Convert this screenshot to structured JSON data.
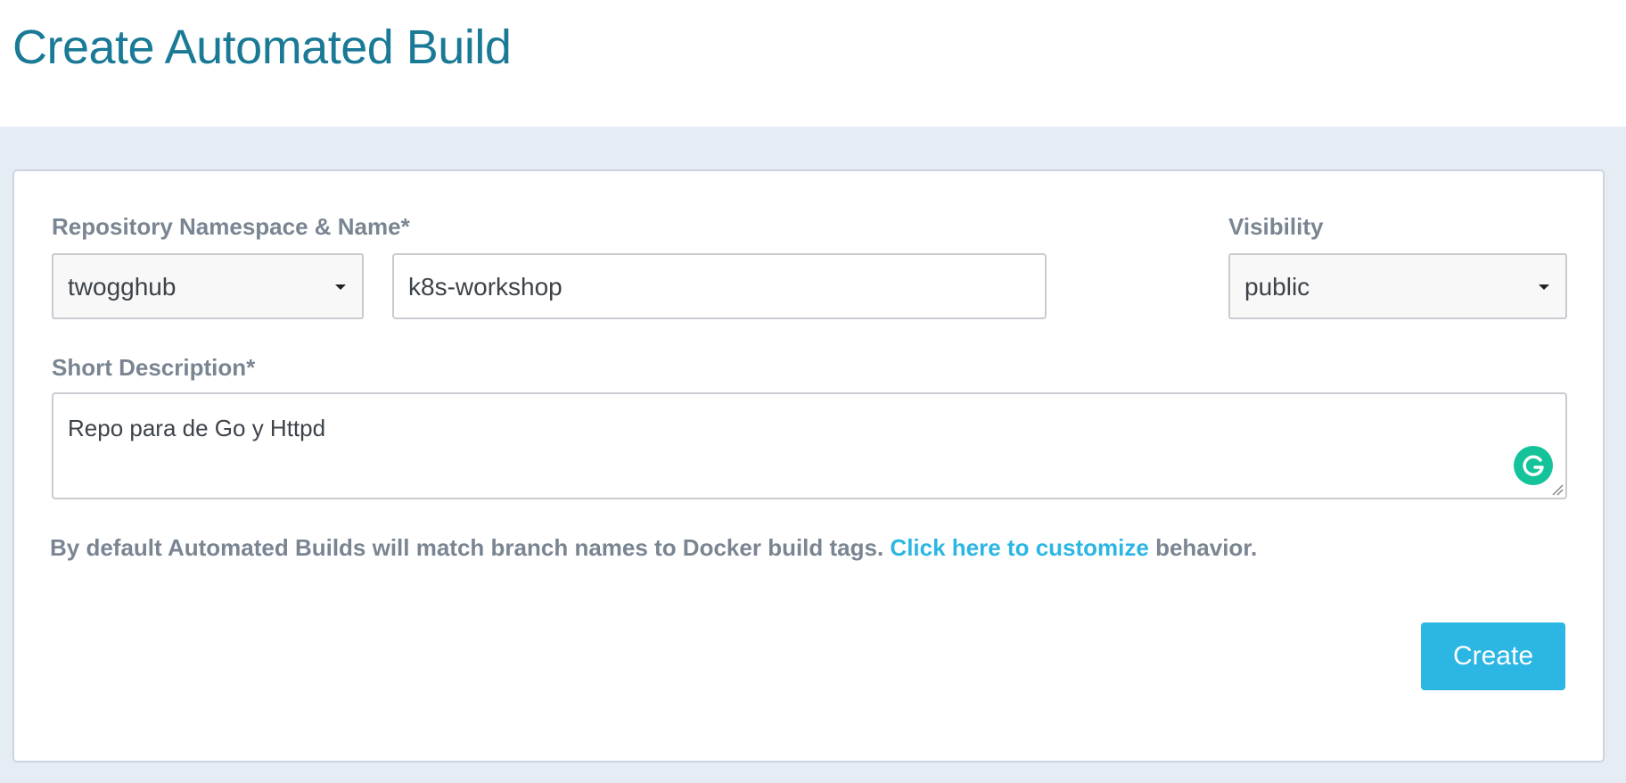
{
  "page": {
    "title": "Create Automated Build"
  },
  "form": {
    "repo_label": "Repository Namespace & Name*",
    "namespace_value": "twogghub",
    "name_value": "k8s-workshop",
    "visibility_label": "Visibility",
    "visibility_value": "public",
    "description_label": "Short Description*",
    "description_value": "Repo para de Go y Httpd",
    "help_prefix": "By default Automated Builds will match branch names to Docker build tags. ",
    "help_link": "Click here to customize",
    "help_suffix": " behavior.",
    "create_label": "Create"
  },
  "colors": {
    "accent": "#2cb6e3",
    "title": "#1a7a96",
    "label": "#7a8592",
    "background": "#e6ecf4",
    "grammarly": "#15c39a"
  },
  "icons": {
    "namespace_dropdown": "caret-down-icon",
    "visibility_dropdown": "caret-down-icon",
    "grammarly": "grammarly-icon",
    "resize": "resize-handle-icon"
  }
}
